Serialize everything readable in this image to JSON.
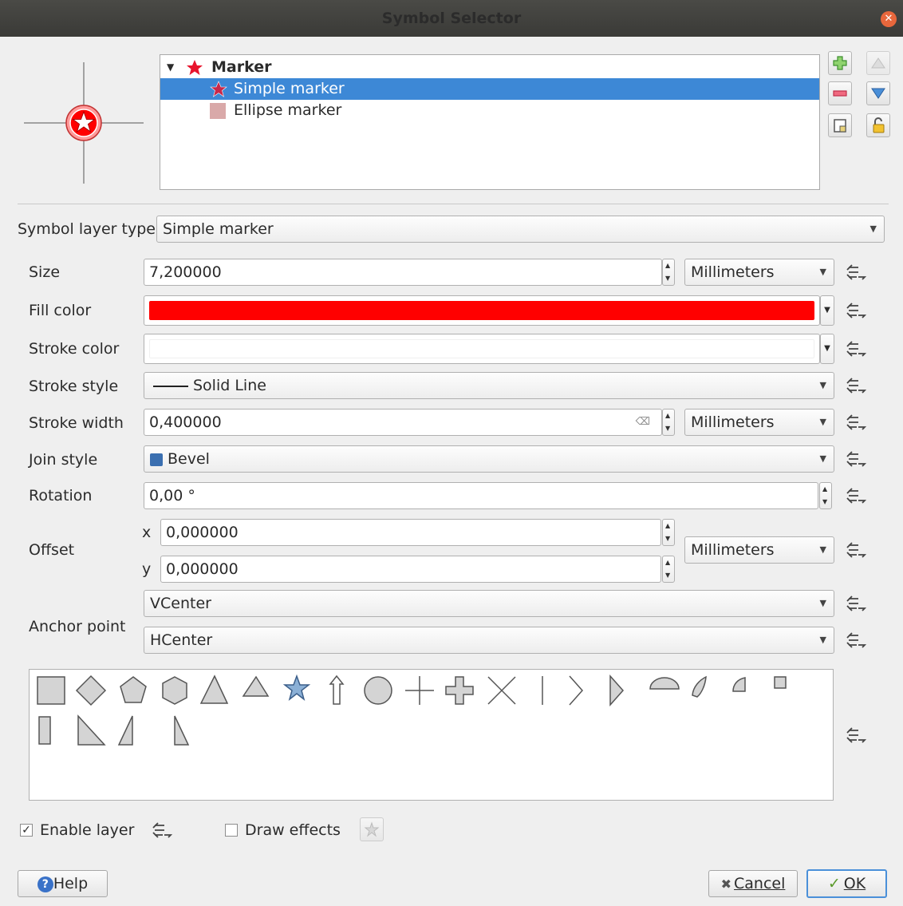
{
  "window": {
    "title": "Symbol Selector"
  },
  "tree": {
    "root_label": "Marker",
    "items": [
      {
        "label": "Simple marker",
        "selected": true
      },
      {
        "label": "Ellipse marker",
        "selected": false
      }
    ]
  },
  "symbol_layer_type": {
    "label": "Symbol layer type",
    "value": "Simple marker"
  },
  "properties": {
    "size": {
      "label": "Size",
      "value": "7,200000",
      "unit": "Millimeters"
    },
    "fill_color": {
      "label": "Fill color",
      "color": "#ff0000"
    },
    "stroke_color": {
      "label": "Stroke color",
      "color": "#ffffff"
    },
    "stroke_style": {
      "label": "Stroke style",
      "value": "Solid Line"
    },
    "stroke_width": {
      "label": "Stroke width",
      "value": "0,400000",
      "unit": "Millimeters"
    },
    "join_style": {
      "label": "Join style",
      "value": "Bevel"
    },
    "rotation": {
      "label": "Rotation",
      "value": "0,00 °"
    },
    "offset": {
      "label": "Offset",
      "x_label": "x",
      "x_value": "0,000000",
      "y_label": "y",
      "y_value": "0,000000",
      "unit": "Millimeters"
    },
    "anchor_point": {
      "label": "Anchor point",
      "vertical": "VCenter",
      "horizontal": "HCenter"
    }
  },
  "shapes": [
    "square",
    "diamond",
    "pentagon",
    "hexagon",
    "triangle",
    "equilateral-triangle",
    "star",
    "arrow",
    "circle",
    "cross",
    "cross-fill",
    "x",
    "line",
    "arrowhead",
    "filled-arrowhead",
    "semi-circle",
    "third-circle",
    "quarter-circle",
    "quarter-square",
    "half-square",
    "right-half-triangle",
    "left-half-triangle",
    "diagonal-half-square"
  ],
  "footer": {
    "enable_layer": {
      "label": "Enable layer",
      "checked": true
    },
    "draw_effects": {
      "label": "Draw effects",
      "checked": false
    },
    "help": "Help",
    "cancel": "Cancel",
    "ok": "OK"
  },
  "colors": {
    "selection": "#3d88d6",
    "accent_red": "#ff0000"
  }
}
